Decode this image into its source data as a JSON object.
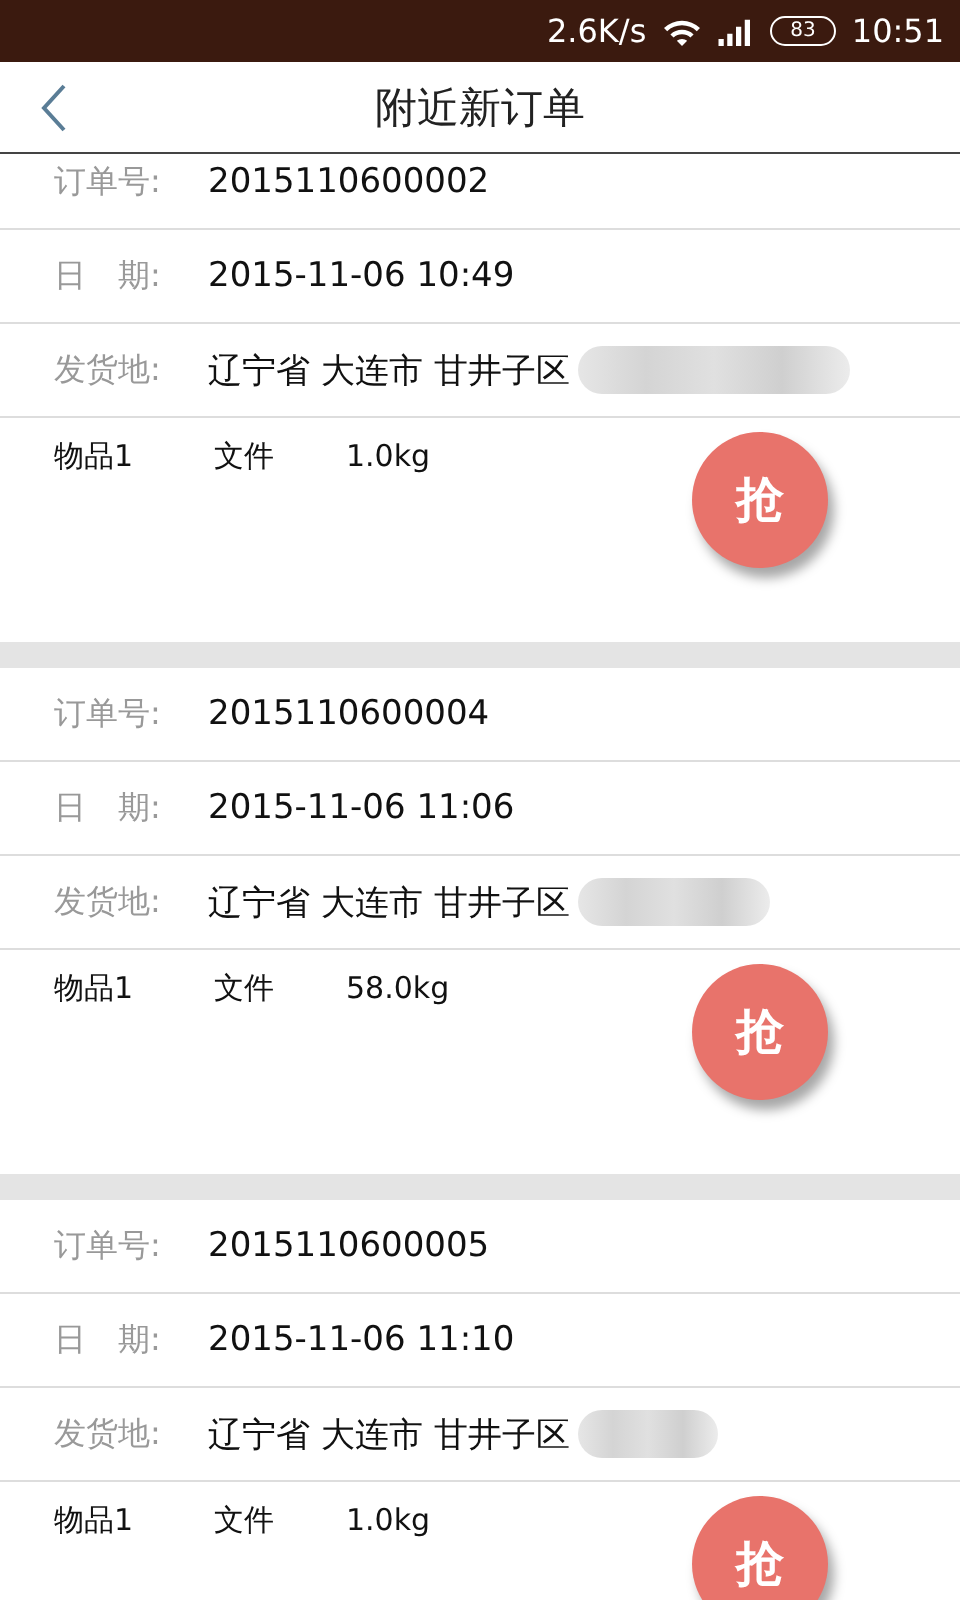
{
  "status_bar": {
    "speed": "2.6K/s",
    "battery": "83",
    "time": "10:51"
  },
  "header": {
    "title": "附近新订单"
  },
  "orders": [
    {
      "fields": [
        {
          "label": "订单号:",
          "value": "2015110600002"
        },
        {
          "label": "日　期:",
          "value": "2015-11-06 10:49"
        },
        {
          "label": "发货地:",
          "value": "辽宁省 大连市 甘井子区"
        }
      ],
      "goods": {
        "name": "物品1",
        "type": "文件",
        "weight": "1.0kg"
      },
      "action": "抢"
    },
    {
      "fields": [
        {
          "label": "订单号:",
          "value": "2015110600004"
        },
        {
          "label": "日　期:",
          "value": "2015-11-06 11:06"
        },
        {
          "label": "发货地:",
          "value": "辽宁省 大连市 甘井子区"
        }
      ],
      "goods": {
        "name": "物品1",
        "type": "文件",
        "weight": "58.0kg"
      },
      "action": "抢"
    },
    {
      "fields": [
        {
          "label": "订单号:",
          "value": "2015110600005"
        },
        {
          "label": "日　期:",
          "value": "2015-11-06 11:10"
        },
        {
          "label": "发货地:",
          "value": "辽宁省 大连市 甘井子区"
        }
      ],
      "goods": {
        "name": "物品1",
        "type": "文件",
        "weight": "1.0kg"
      },
      "action": "抢"
    }
  ]
}
